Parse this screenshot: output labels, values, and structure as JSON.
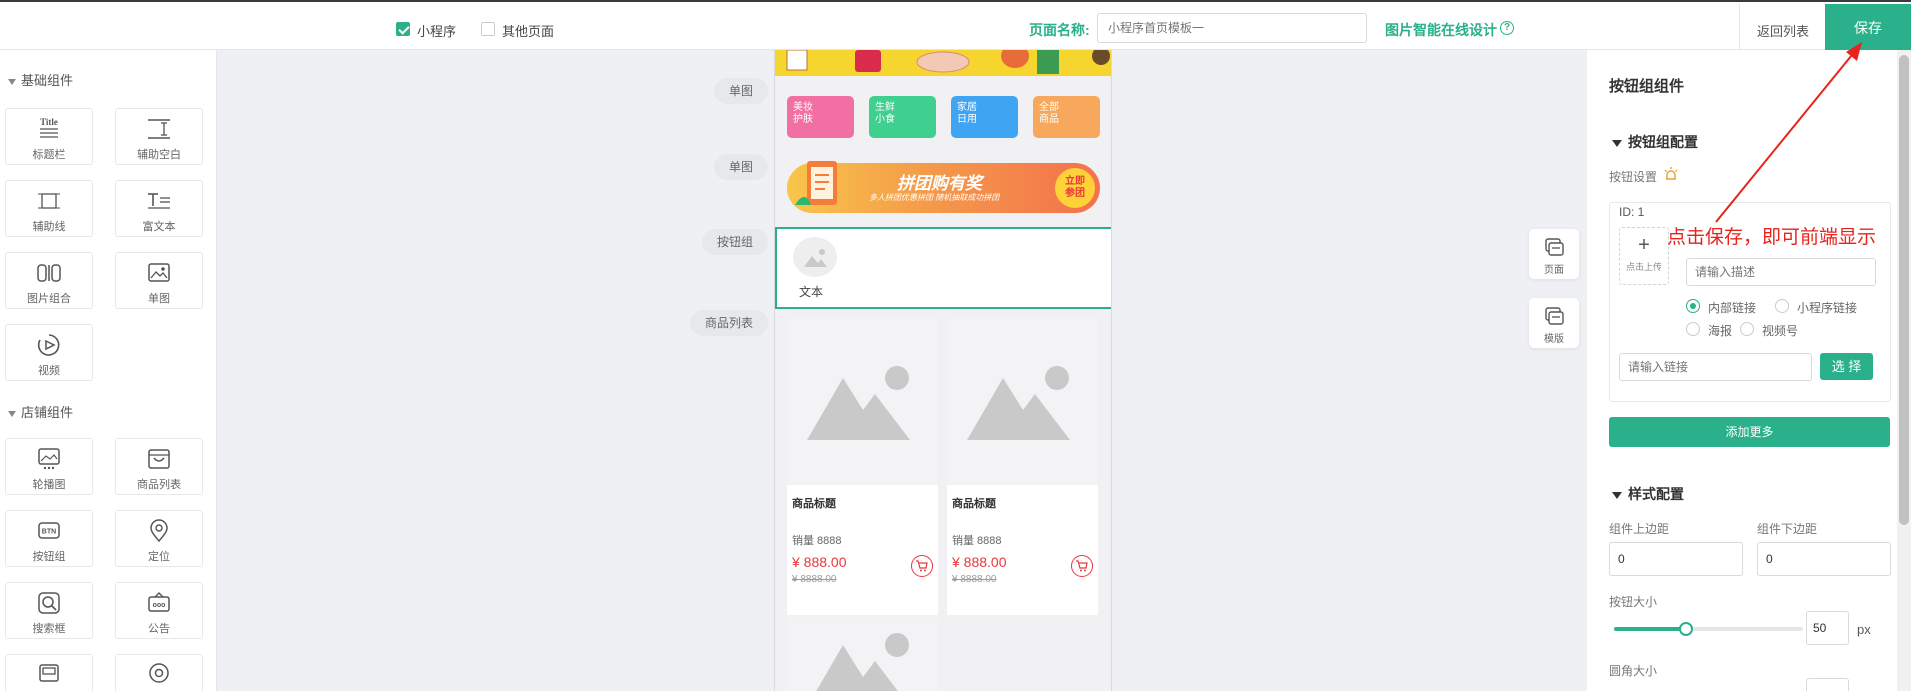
{
  "header": {
    "miniprogram_label": "小程序",
    "other_pages_label": "其他页面",
    "page_name_label": "页面名称:",
    "page_name_placeholder": "小程序首页模板一",
    "image_design_link": "图片智能在线设计",
    "back_label": "返回列表",
    "save_label": "保存"
  },
  "left_panel": {
    "basic_section": "基础组件",
    "basic_items": [
      {
        "label": "标题栏",
        "icon": "title-icon"
      },
      {
        "label": "辅助空白",
        "icon": "blank-space-icon"
      },
      {
        "label": "辅助线",
        "icon": "divider-line-icon"
      },
      {
        "label": "富文本",
        "icon": "rich-text-icon"
      },
      {
        "label": "图片组合",
        "icon": "image-combo-icon"
      },
      {
        "label": "单图",
        "icon": "single-image-icon"
      },
      {
        "label": "视频",
        "icon": "video-icon"
      }
    ],
    "title_icon_text": "Title",
    "shop_section": "店铺组件",
    "shop_items": [
      {
        "label": "轮播图",
        "icon": "carousel-icon"
      },
      {
        "label": "商品列表",
        "icon": "product-list-icon"
      },
      {
        "label": "按钮组",
        "icon": "button-group-icon"
      },
      {
        "label": "定位",
        "icon": "location-icon"
      },
      {
        "label": "搜索框",
        "icon": "search-box-icon"
      },
      {
        "label": "公告",
        "icon": "notice-icon"
      },
      {
        "label": "",
        "icon": "module-icon"
      },
      {
        "label": "",
        "icon": "circle-icon"
      }
    ],
    "btn_icon_text": "BTN",
    "notice_icon_text": "ooo"
  },
  "canvas_labels": [
    "单图",
    "单图",
    "按钮组",
    "商品列表"
  ],
  "phone": {
    "categories": [
      {
        "line1": "美妆",
        "line2": "护肤",
        "color": "#f26fa3"
      },
      {
        "line1": "生鲜",
        "line2": "小食",
        "color": "#3fcf8e"
      },
      {
        "line1": "家居",
        "line2": "日用",
        "color": "#3fa5f2"
      },
      {
        "line1": "全部",
        "line2": "商品",
        "color": "#f7a85c"
      }
    ],
    "banner_title": "拼团购有奖",
    "banner_sub": "多人拼团优惠拼团 随机抽取成功拼团",
    "banner_badge_line1": "立即",
    "banner_badge_line2": "参团",
    "button_text": "文本",
    "products": [
      {
        "title": "商品标题",
        "sales": "销量 8888",
        "price": "¥ 888.00",
        "old_price": "¥ 8888.00"
      },
      {
        "title": "商品标题",
        "sales": "销量 8888",
        "price": "¥ 888.00",
        "old_price": "¥ 8888.00"
      }
    ]
  },
  "side_buttons": [
    "页面",
    "模版"
  ],
  "right_panel": {
    "title": "按钮组组件",
    "config_section": "按钮组配置",
    "button_settings_label": "按钮设置",
    "id_label": "ID:  1",
    "upload_label": "点击上传",
    "desc_placeholder": "请输入描述",
    "link_types": [
      "内部链接",
      "小程序链接",
      "海报",
      "视频号"
    ],
    "link_placeholder": "请输入链接",
    "select_label": "选 择",
    "add_more_label": "添加更多",
    "style_section": "样式配置",
    "top_margin_label": "组件上边距",
    "bottom_margin_label": "组件下边距",
    "top_margin_value": "0",
    "bottom_margin_value": "0",
    "button_size_label": "按钮大小",
    "button_size_value": "50",
    "button_size_unit": "px",
    "button_size_fraction": 0.38,
    "radius_label": "圆角大小"
  },
  "annotation": "点击保存，即可前端显示",
  "colors": {
    "accent": "#2ab08a",
    "price": "#e9383b",
    "annotation": "#e8231c"
  }
}
